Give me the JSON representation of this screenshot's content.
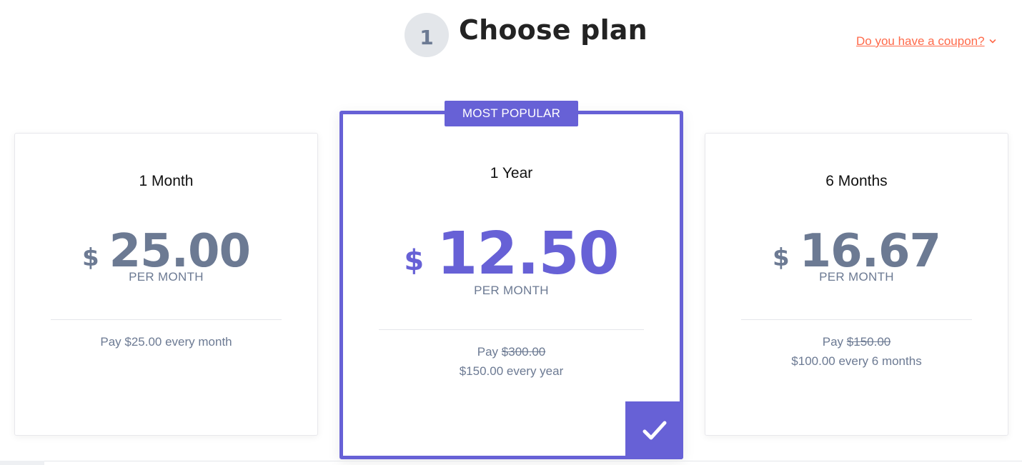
{
  "header": {
    "step_number": "1",
    "title": "Choose plan",
    "coupon_label": "Do you have a coupon?"
  },
  "colors": {
    "accent": "#6761d6",
    "coupon": "#ff6a4a",
    "muted": "#6c7a93"
  },
  "plans": [
    {
      "name": "1 Month",
      "currency": "$",
      "amount": "25.00",
      "period": "PER MONTH",
      "pay_line1_prefix": "Pay $25.00 every month",
      "selected": false
    },
    {
      "name": "1 Year",
      "badge": "MOST POPULAR",
      "currency": "$",
      "amount": "12.50",
      "period": "PER MONTH",
      "pay_prefix": "Pay ",
      "pay_original": "$300.00",
      "pay_line2": "$150.00 every year",
      "selected": true,
      "selected_icon": "check-icon"
    },
    {
      "name": "6 Months",
      "currency": "$",
      "amount": "16.67",
      "period": "PER MONTH",
      "pay_prefix": "Pay ",
      "pay_original": "$150.00",
      "pay_line2": "$100.00 every 6 months",
      "selected": false
    }
  ]
}
